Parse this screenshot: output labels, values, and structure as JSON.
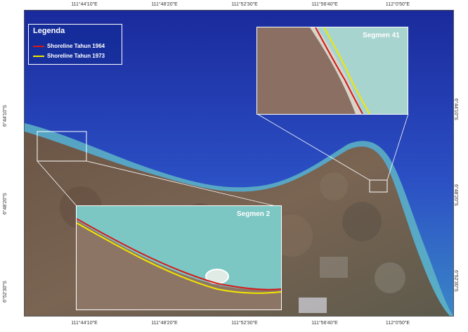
{
  "legend": {
    "title": "Legenda",
    "items": [
      {
        "label": "Shoreline Tahun 1964",
        "color": "#d31a1a"
      },
      {
        "label": "Shoreline Tahun 1973",
        "color": "#f2e600"
      }
    ]
  },
  "graticule": {
    "top": [
      "111°44'10\"E",
      "111°48'20\"E",
      "111°52'30\"E",
      "111°56'40\"E",
      "112°0'50\"E"
    ],
    "bottom": [
      "111°44'10\"E",
      "111°48'20\"E",
      "111°52'30\"E",
      "111°56'40\"E",
      "112°0'50\"E"
    ],
    "left": [
      "6°44'10\"S",
      "6°48'20\"S",
      "6°52'30\"S"
    ],
    "right": [
      "6°44'10\"S",
      "6°48'20\"S",
      "6°52'30\"S"
    ]
  },
  "insets": {
    "segment_2": {
      "title": "Segmen 2"
    },
    "segment_41": {
      "title": "Segmen 41"
    }
  },
  "colors": {
    "deep_sea": "#1f2fa8",
    "shallow_sea": "#7ec8c8",
    "land": "#6e5a4a"
  }
}
